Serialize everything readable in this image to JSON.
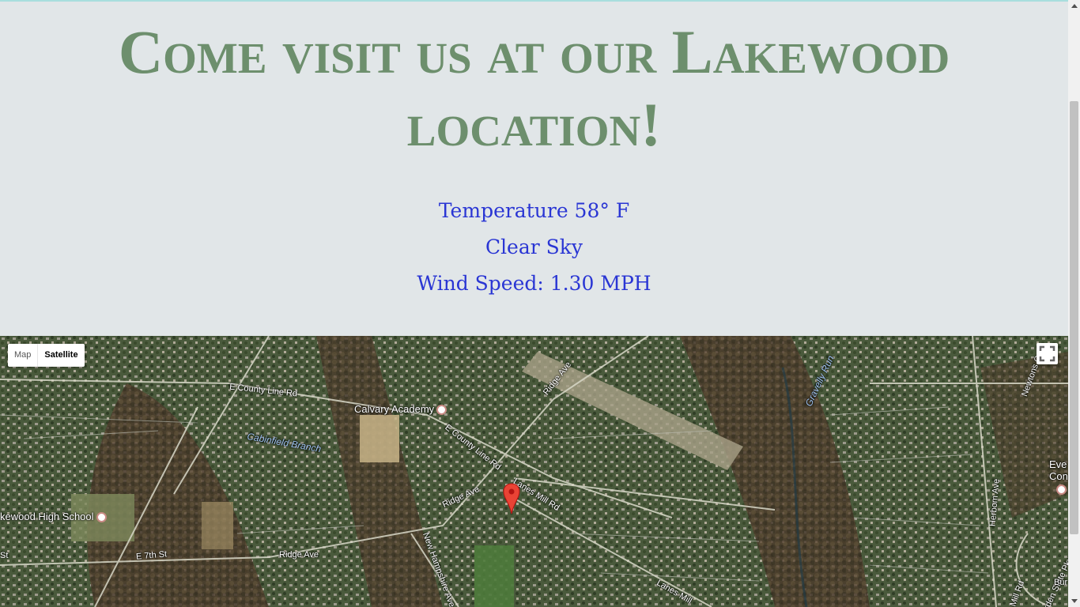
{
  "heading": "Come visit us at our Lakewood location!",
  "weather": {
    "temperature": "Temperature 58° F",
    "condition": "Clear Sky",
    "wind": "Wind Speed: 1.30 MPH"
  },
  "map": {
    "type_controls": {
      "map": "Map",
      "satellite": "Satellite",
      "selected": "Satellite"
    },
    "labels": {
      "e_county_line_rd": "E County Line Rd",
      "calvary_academy": "Calvary Academy",
      "cabinfield_branch": "Cabinfield Branch",
      "e_county_line_rd_2": "E County Line Rd",
      "ridge_ave_1": "Ridge Ave",
      "ridge_ave_2": "Ridge Ave",
      "ridge_ave_3": "Ridge Ave",
      "lanes_mill_rd": "Lanes Mill Rd",
      "lanes_mill_2": "Lanes Mill",
      "high_school": "kewood High School",
      "e_7th_st": "E 7th St",
      "st": "St",
      "new_hampshire_ave": "New Hampshire Ave",
      "gravelly_run": "Gravelly Run",
      "newtons": "Newtons C",
      "hearborn_ave": "Herbom Ave",
      "garden_state_pkwy": "Garden State Pkwy",
      "mill_rd": "Mill Rd",
      "eve": "Eve",
      "con": "Con",
      "bur": "Bur"
    }
  }
}
